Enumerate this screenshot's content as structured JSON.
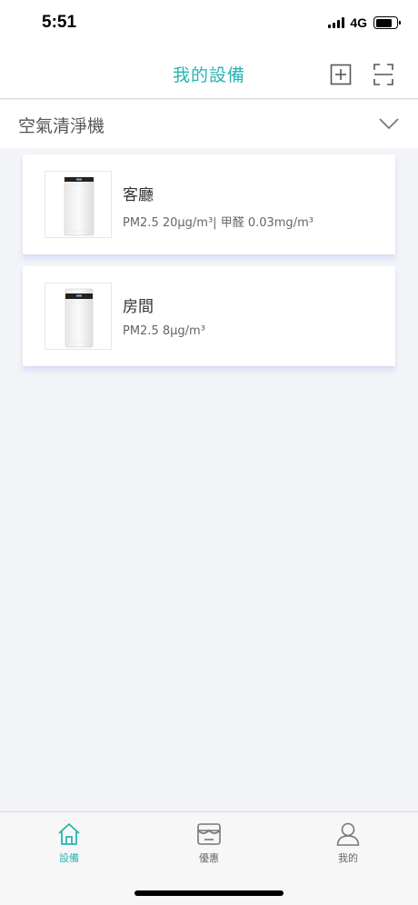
{
  "status_bar": {
    "time": "5:51",
    "network": "4G"
  },
  "nav": {
    "title": "我的設備",
    "add_icon": "add-square-icon",
    "scan_icon": "scan-icon"
  },
  "category": {
    "label": "空氣清淨機",
    "toggle_icon": "chevron-down-icon"
  },
  "devices": [
    {
      "name": "客廳",
      "reading": "PM2.5 20μg/m³| 甲醛 0.03mg/m³",
      "image": "air-purifier-image"
    },
    {
      "name": "房間",
      "reading": "PM2.5 8μg/m³",
      "image": "air-purifier-image"
    }
  ],
  "tabs": [
    {
      "label": "設備",
      "icon": "home-icon",
      "active": true
    },
    {
      "label": "優惠",
      "icon": "store-icon",
      "active": false
    },
    {
      "label": "我的",
      "icon": "user-icon",
      "active": false
    }
  ],
  "colors": {
    "accent": "#2ab3b0",
    "background": "#f3f4f7"
  }
}
